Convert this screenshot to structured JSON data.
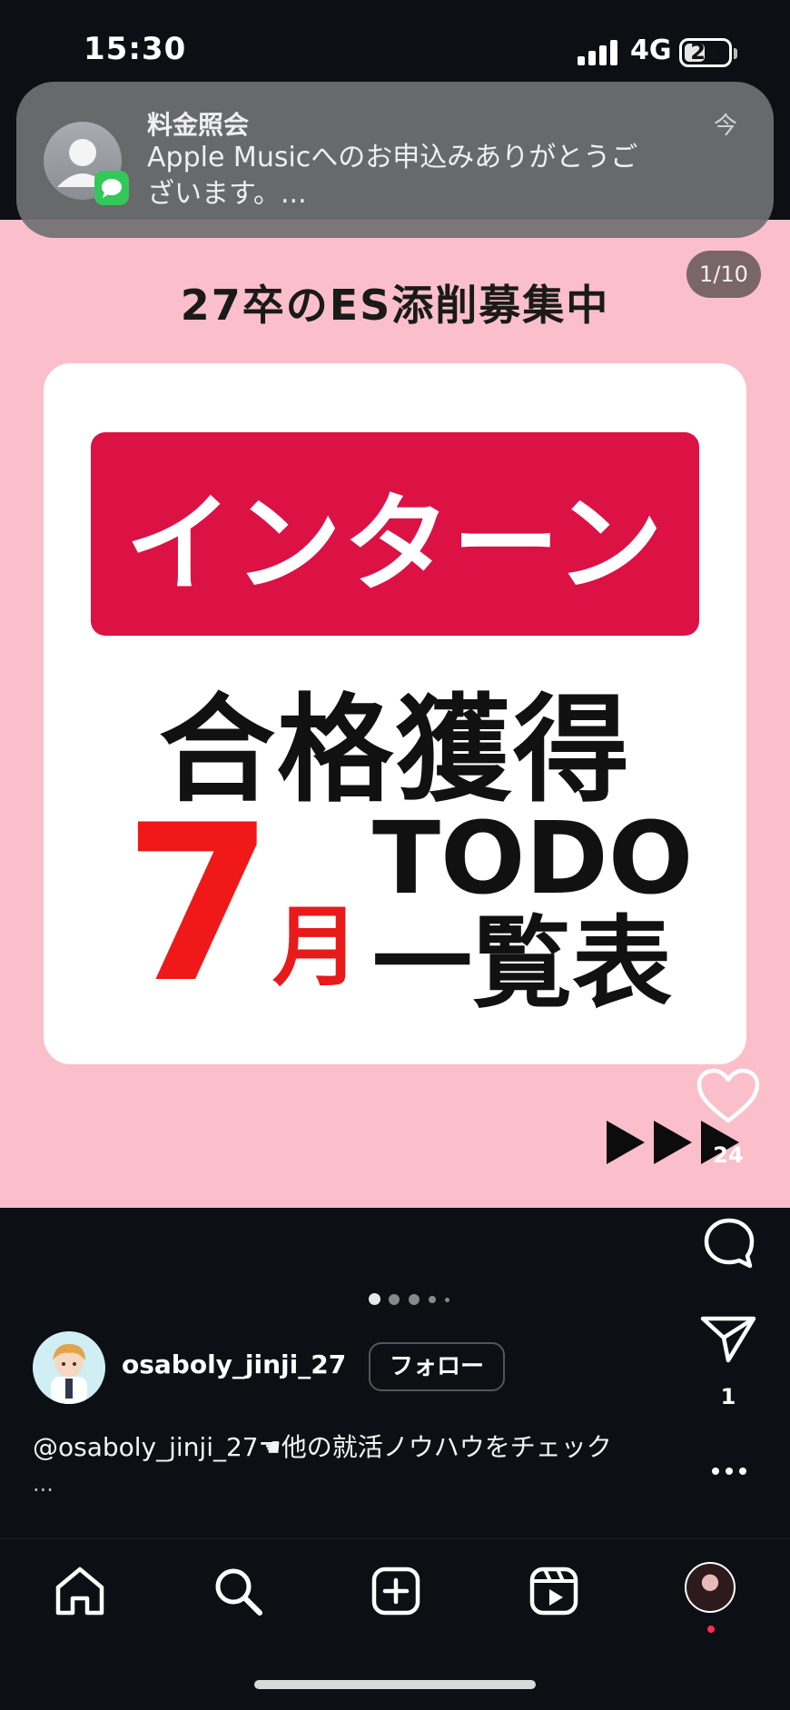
{
  "status_bar": {
    "time": "15:30",
    "network": "4G",
    "battery": "21"
  },
  "notification": {
    "title": "料金照会",
    "body": "Apple Musicへのお申込みありがとうございます。...",
    "time": "今"
  },
  "slide": {
    "counter": "1/10",
    "header": "27卒のES添削募集中",
    "banner": "インターン",
    "main": "合格獲得",
    "month_number": "7",
    "month_char": "月",
    "todo": "TODO",
    "list": "一覧表"
  },
  "actions": {
    "like_count": "24",
    "share_count": "1"
  },
  "author": {
    "username": "osaboly_jinji_27",
    "follow_label": "フォロー"
  },
  "caption": {
    "text": "@osaboly_jinji_27☚他の就活ノウハウをチェック",
    "more": "..."
  },
  "icons": {
    "like": "heart-icon",
    "comment": "comment-icon",
    "share": "paper-plane-icon",
    "more": "more-icon",
    "home": "home-icon",
    "search": "search-icon",
    "create": "plus-square-icon",
    "reels": "reels-icon",
    "profile": "profile-avatar"
  },
  "colors": {
    "slide_bg": "#fbbfcb",
    "banner_red": "#dc1244",
    "month_red": "#f01818",
    "app_bg": "#0c0f14"
  }
}
